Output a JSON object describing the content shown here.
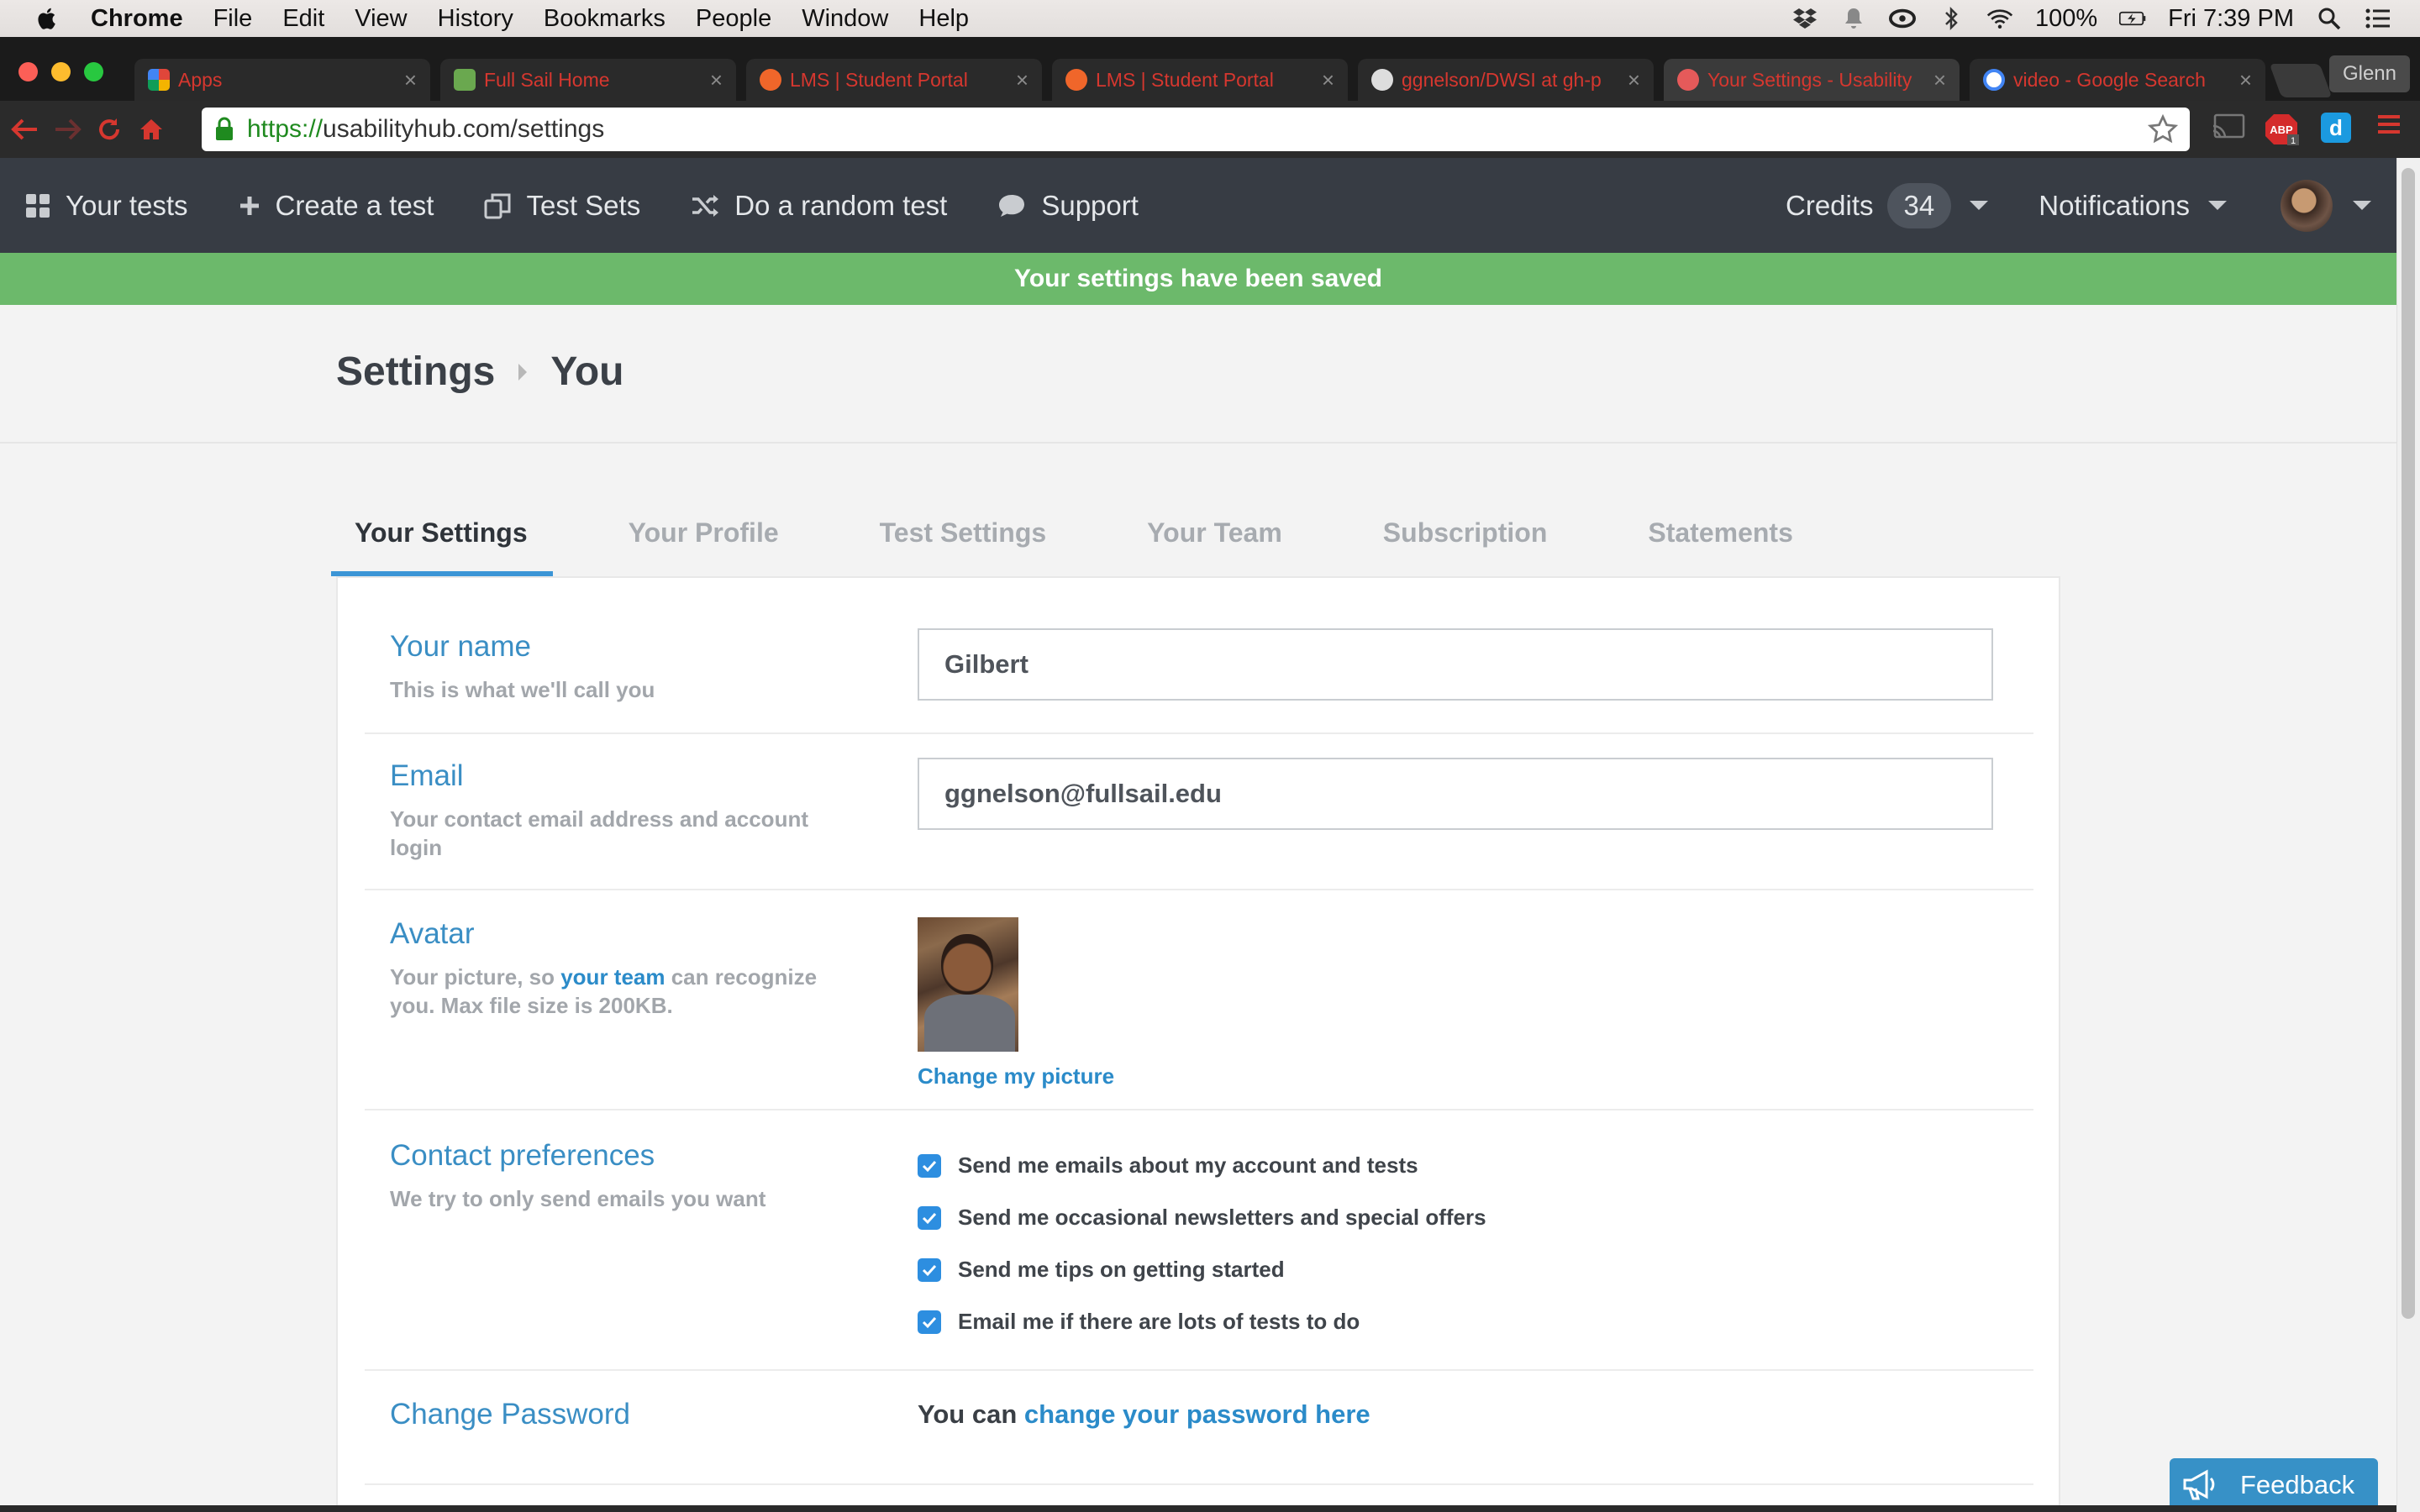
{
  "menubar": {
    "app": "Chrome",
    "items": [
      "File",
      "Edit",
      "View",
      "History",
      "Bookmarks",
      "People",
      "Window",
      "Help"
    ],
    "battery": "100%",
    "clock": "Fri 7:39 PM"
  },
  "tabs": [
    {
      "title": "Apps",
      "active": false,
      "favicon_color": "#e0463a"
    },
    {
      "title": "Full Sail Home",
      "active": false,
      "favicon_color": "#6aa84f"
    },
    {
      "title": "LMS | Student Portal",
      "active": false,
      "favicon_color": "#f0662a"
    },
    {
      "title": "LMS | Student Portal",
      "active": false,
      "favicon_color": "#f0662a"
    },
    {
      "title": "ggnelson/DWSI at gh-p",
      "active": false,
      "favicon_color": "#dddddd"
    },
    {
      "title": "Your Settings - Usability",
      "active": true,
      "favicon_color": "#e55a5a"
    },
    {
      "title": "video - Google Search",
      "active": false,
      "favicon_color": "#4285f4"
    }
  ],
  "profile_name": "Glenn",
  "address": {
    "scheme": "https://",
    "host_path": "usabilityhub.com/settings"
  },
  "sitenav": {
    "items": [
      "Your tests",
      "Create a test",
      "Test Sets",
      "Do a random test",
      "Support"
    ],
    "credits_label": "Credits",
    "credits_value": "34",
    "notifications_label": "Notifications"
  },
  "banner": "Your settings have been saved",
  "breadcrumb": {
    "root": "Settings",
    "current": "You"
  },
  "settings_tabs": [
    "Your Settings",
    "Your Profile",
    "Test Settings",
    "Your Team",
    "Subscription",
    "Statements"
  ],
  "form": {
    "name": {
      "label": "Your name",
      "help": "This is what we'll call you",
      "value": "Gilbert"
    },
    "email": {
      "label": "Email",
      "help": "Your contact email address and account login",
      "value": "ggnelson@fullsail.edu"
    },
    "avatar": {
      "label": "Avatar",
      "help_before": "Your picture, so ",
      "help_link": "your team",
      "help_after": " can recognize you. Max file size is 200KB.",
      "change_link": "Change my picture"
    },
    "contact": {
      "label": "Contact preferences",
      "help": "We try to only send emails you want",
      "options": [
        {
          "text": "Send me emails about my account and tests",
          "checked": true
        },
        {
          "text": "Send me occasional newsletters and special offers",
          "checked": true
        },
        {
          "text": "Send me tips on getting started",
          "checked": true
        },
        {
          "text": "Email me if there are lots of tests to do",
          "checked": true
        }
      ]
    },
    "password": {
      "label": "Change Password",
      "prefix": "You can ",
      "link": "change your password here"
    }
  },
  "feedback_label": "Feedback",
  "colors": {
    "nav_bg": "#373c44",
    "banner": "#6cb96b",
    "accent": "#3a8ec4",
    "link": "#2b8bc9",
    "checkbox": "#2d8ee0"
  }
}
